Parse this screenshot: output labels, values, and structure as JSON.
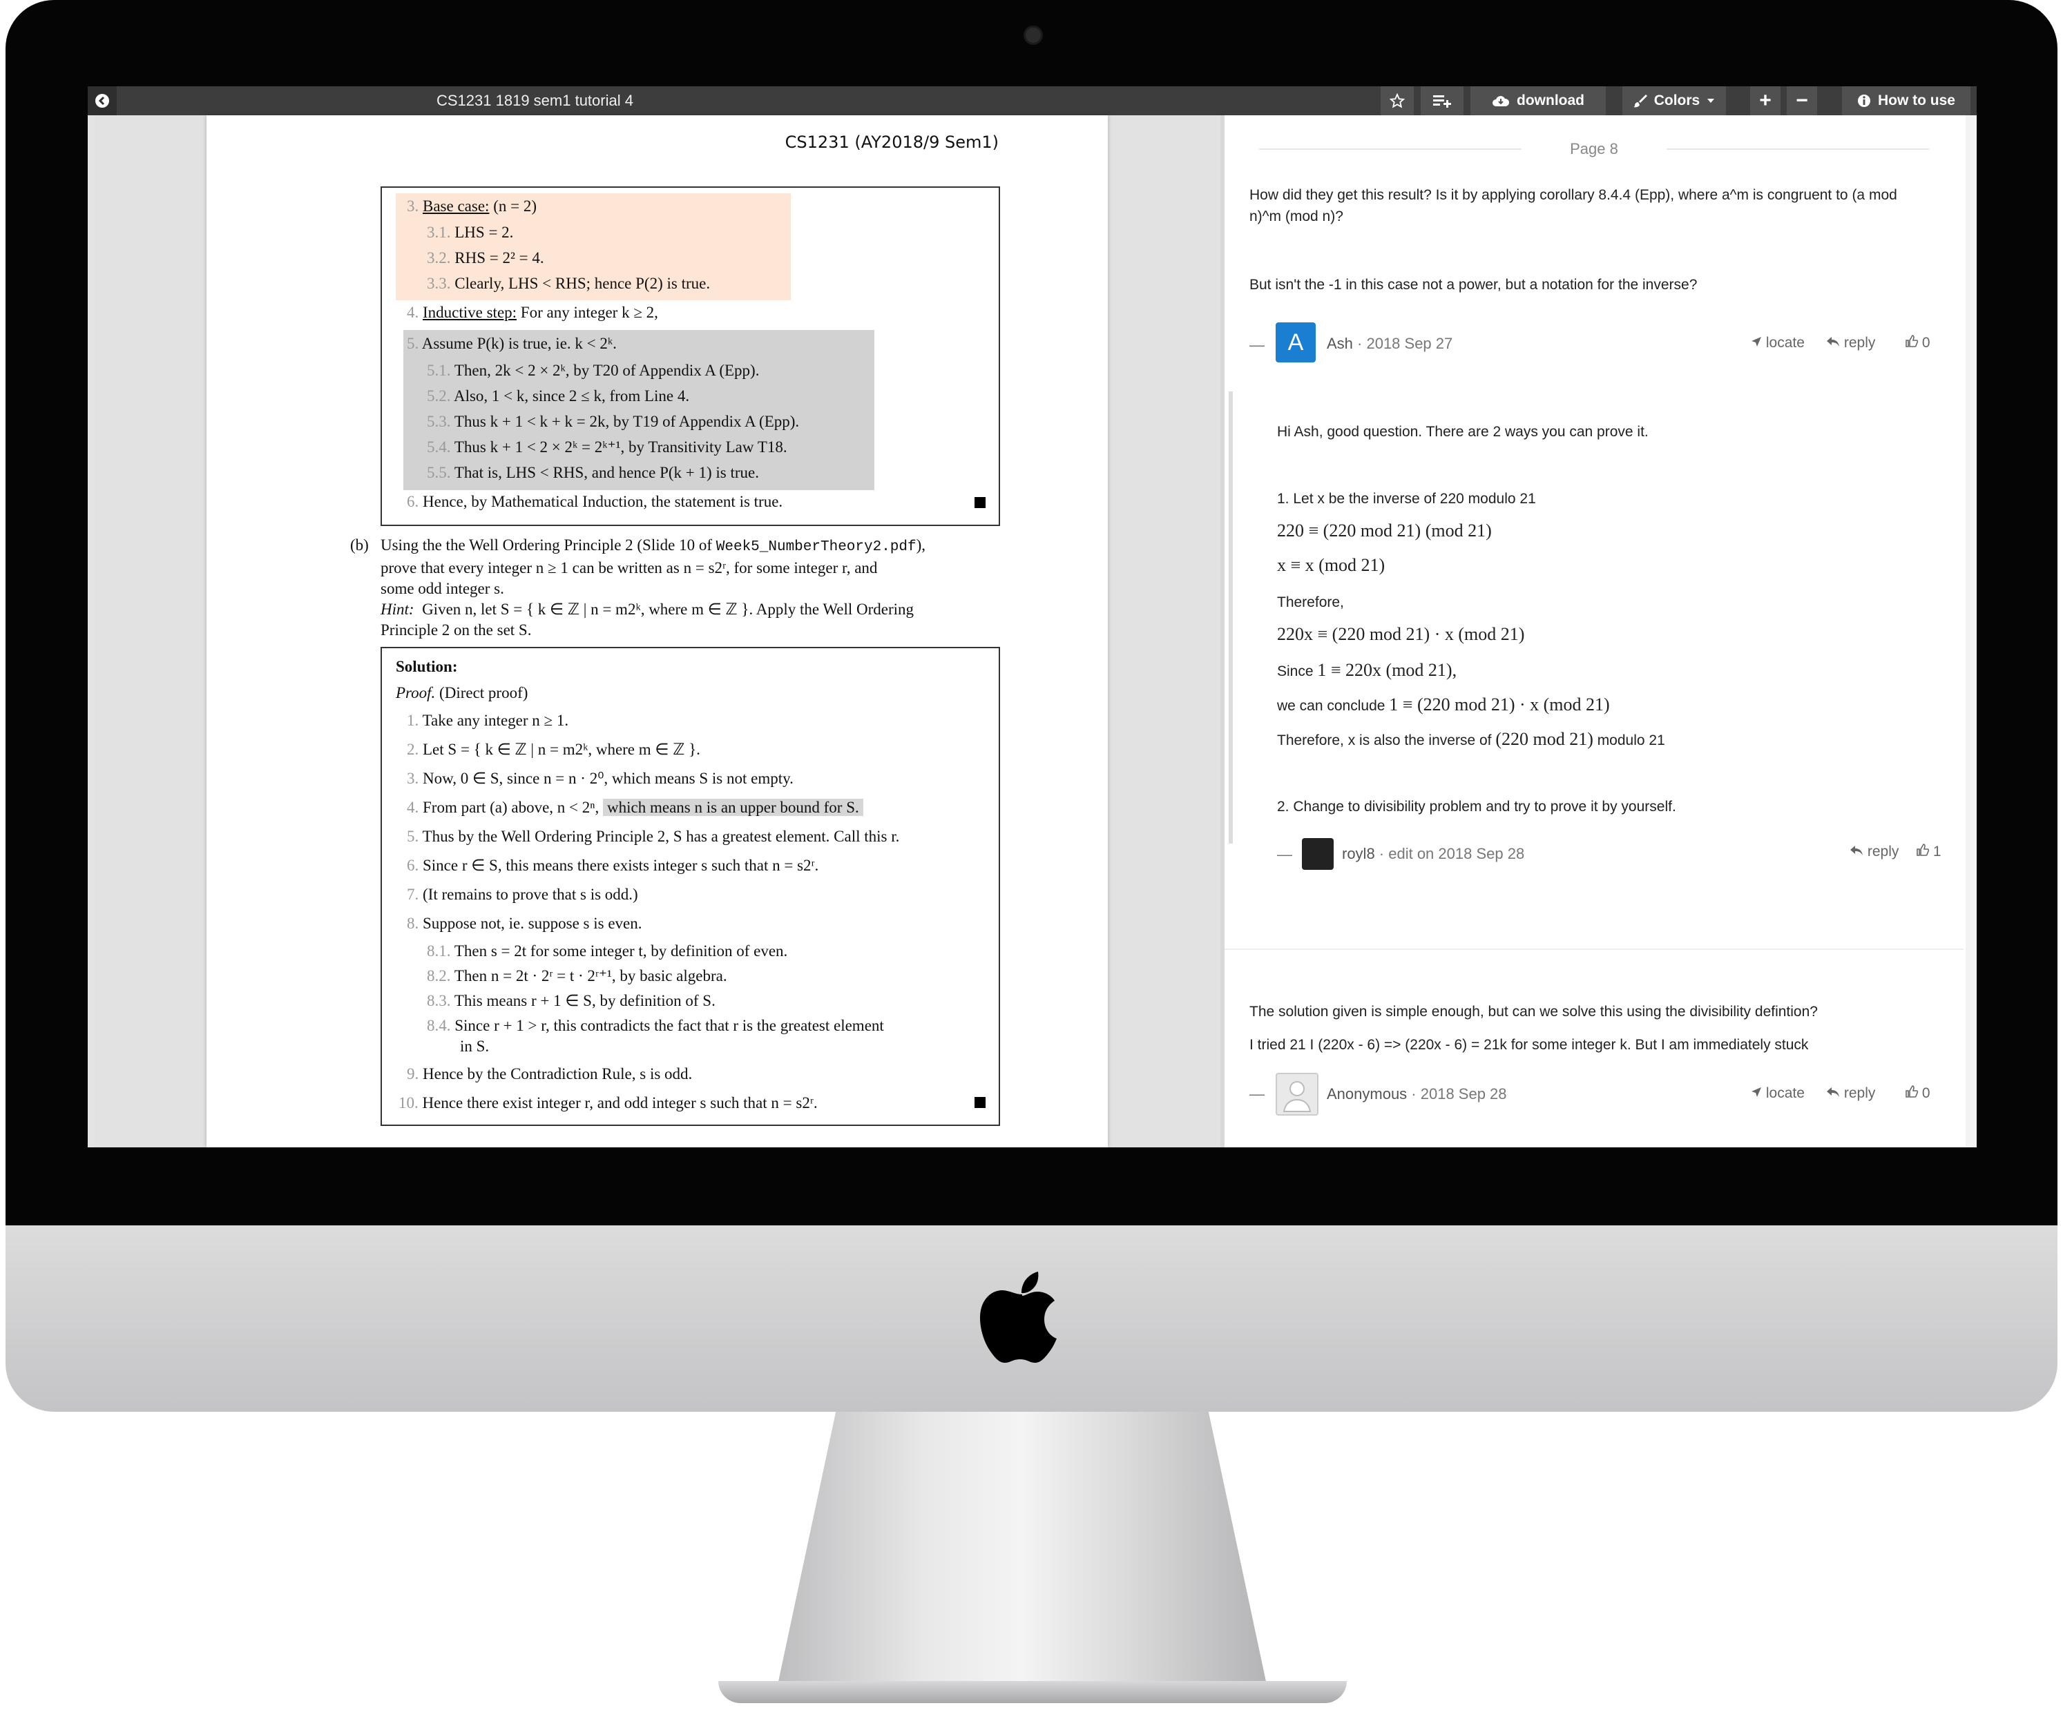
{
  "toolbar": {
    "title": "CS1231 1819 sem1 tutorial 4",
    "download_label": "download",
    "colors_label": "Colors",
    "zoom_in_label": "+",
    "zoom_out_label": "−",
    "how_to_use_label": "How to use",
    "icons": [
      "back-icon",
      "star-icon",
      "playlist-add-icon",
      "cloud-download-icon",
      "brush-icon",
      "caret-down-icon",
      "info-icon"
    ]
  },
  "pdf": {
    "header": "CS1231 (AY2018/9 Sem1)",
    "box1": [
      {
        "num": "3.",
        "label": "Base case:",
        "text": " (n = 2)"
      },
      {
        "num": "3.1.",
        "text": "LHS = 2."
      },
      {
        "num": "3.2.",
        "text": "RHS = 2² = 4."
      },
      {
        "num": "3.3.",
        "text": "Clearly, LHS < RHS; hence P(2) is true."
      },
      {
        "num": "4.",
        "label": "Inductive step:",
        "text": " For any integer k ≥ 2,"
      },
      {
        "num": "5.",
        "text": "Assume P(k) is true, ie. k < 2ᵏ."
      },
      {
        "num": "5.1.",
        "text": "Then, 2k < 2 × 2ᵏ, by T20 of Appendix A (Epp)."
      },
      {
        "num": "5.2.",
        "text": "Also, 1 < k, since 2 ≤ k, from Line 4."
      },
      {
        "num": "5.3.",
        "text": "Thus k + 1 < k + k = 2k, by T19 of Appendix A (Epp)."
      },
      {
        "num": "5.4.",
        "text": "Thus k + 1 < 2 × 2ᵏ = 2ᵏ⁺¹, by Transitivity Law T18."
      },
      {
        "num": "5.5.",
        "text": "That is, LHS < RHS, and hence P(k + 1) is true."
      },
      {
        "num": "6.",
        "text": "Hence, by Mathematical Induction, the statement is true."
      }
    ],
    "part_b": {
      "label": "(b)",
      "line1_pre": "Using the the Well Ordering Principle 2 (Slide 10 of ",
      "line1_file": "Week5_NumberTheory2.pdf",
      "line1_post": "),",
      "line2": "prove that every integer n ≥ 1 can be written as n = s2ʳ, for some integer r, and",
      "line3": "some odd integer s.",
      "hint_label": "Hint:",
      "hint_text": "Given n, let S = { k ∈ ℤ | n = m2ᵏ,  where m ∈ ℤ }. Apply the Well Ordering",
      "hint_line2": "Principle 2 on the set S."
    },
    "solution": {
      "title": "Solution:",
      "proof_label": "Proof.",
      "proof_type": " (Direct proof)",
      "lines": [
        {
          "num": "1.",
          "text": "Take any integer n ≥ 1."
        },
        {
          "num": "2.",
          "text": "Let S = { k ∈ ℤ | n = m2ᵏ,  where m ∈ ℤ }."
        },
        {
          "num": "3.",
          "text": "Now, 0 ∈ S, since n = n · 2⁰, which means S is not empty."
        },
        {
          "num": "4.",
          "text": "From part (a) above, n < 2ⁿ, ",
          "highlight": "which means n is an upper bound for S."
        },
        {
          "num": "5.",
          "text": "Thus by the Well Ordering Principle 2, S has a greatest element. Call this r."
        },
        {
          "num": "6.",
          "text": "Since r ∈ S, this means there exists integer s such that n = s2ʳ."
        },
        {
          "num": "7.",
          "text": "(It remains to prove that s is odd.)"
        },
        {
          "num": "8.",
          "text": "Suppose not, ie. suppose s is even."
        },
        {
          "num": "8.1.",
          "text": "Then s = 2t for some integer t, by definition of even."
        },
        {
          "num": "8.2.",
          "text": "Then n = 2t · 2ʳ = t · 2ʳ⁺¹, by basic algebra."
        },
        {
          "num": "8.3.",
          "text": "This means r + 1 ∈ S, by definition of S."
        },
        {
          "num": "8.4.",
          "text": "Since r + 1 > r, this contradicts the fact that r is the greatest element"
        },
        {
          "num": "",
          "text": "in S."
        },
        {
          "num": "9.",
          "text": "Hence by the Contradiction Rule, s is odd."
        },
        {
          "num": "10.",
          "text": "Hence there exist integer r, and odd integer s such that n = s2ʳ."
        }
      ]
    }
  },
  "comments": {
    "page_label": "Page 8",
    "thread1": {
      "text1": "How did they get this result? Is it by applying corollary 8.4.4 (Epp), where a^m is congruent to (a mod",
      "text1b": "n)^m (mod n)?",
      "text2": "But isn't the -1 in this case not a power, but a notation for the inverse?",
      "avatar": "A",
      "author": "Ash",
      "date": " · 2018 Sep 27",
      "locate": "locate",
      "reply": "reply",
      "likes": "0"
    },
    "reply1": {
      "intro": "Hi Ash, good question. There are 2 ways you can prove it.",
      "step1": "1. Let x be the inverse of 220 modulo 21",
      "m1": "220 ≡ (220 mod 21)   (mod 21)",
      "m2": "x ≡ x (mod 21)",
      "therefore1": "Therefore,",
      "m3": "220x ≡ (220 mod 21) · x   (mod 21)",
      "since_pre": "Since ",
      "since_math": "1 ≡ 220x   (mod 21),",
      "conclude_pre": "we can conclude ",
      "conclude_math": "1 ≡ (220 mod 21) · x   (mod 21)",
      "therefore2_pre": "Therefore, x is also the inverse of ",
      "therefore2_math": "(220 mod 21)",
      "therefore2_post": " modulo 21",
      "step2": "2. Change to divisibility problem and try to prove it by yourself.",
      "author": "royl8",
      "date": " · edit on 2018 Sep 28",
      "reply": "reply",
      "likes": "1"
    },
    "thread2": {
      "text1": "The solution given is simple enough, but can we solve this using the divisibility defintion?",
      "text2": "I tried 21 I (220x - 6) => (220x - 6) = 21k for some integer k. But I am immediately stuck",
      "author": "Anonymous",
      "date": " · 2018 Sep 28",
      "locate": "locate",
      "reply": "reply",
      "likes": "0"
    },
    "collapse_symbol": "—"
  }
}
